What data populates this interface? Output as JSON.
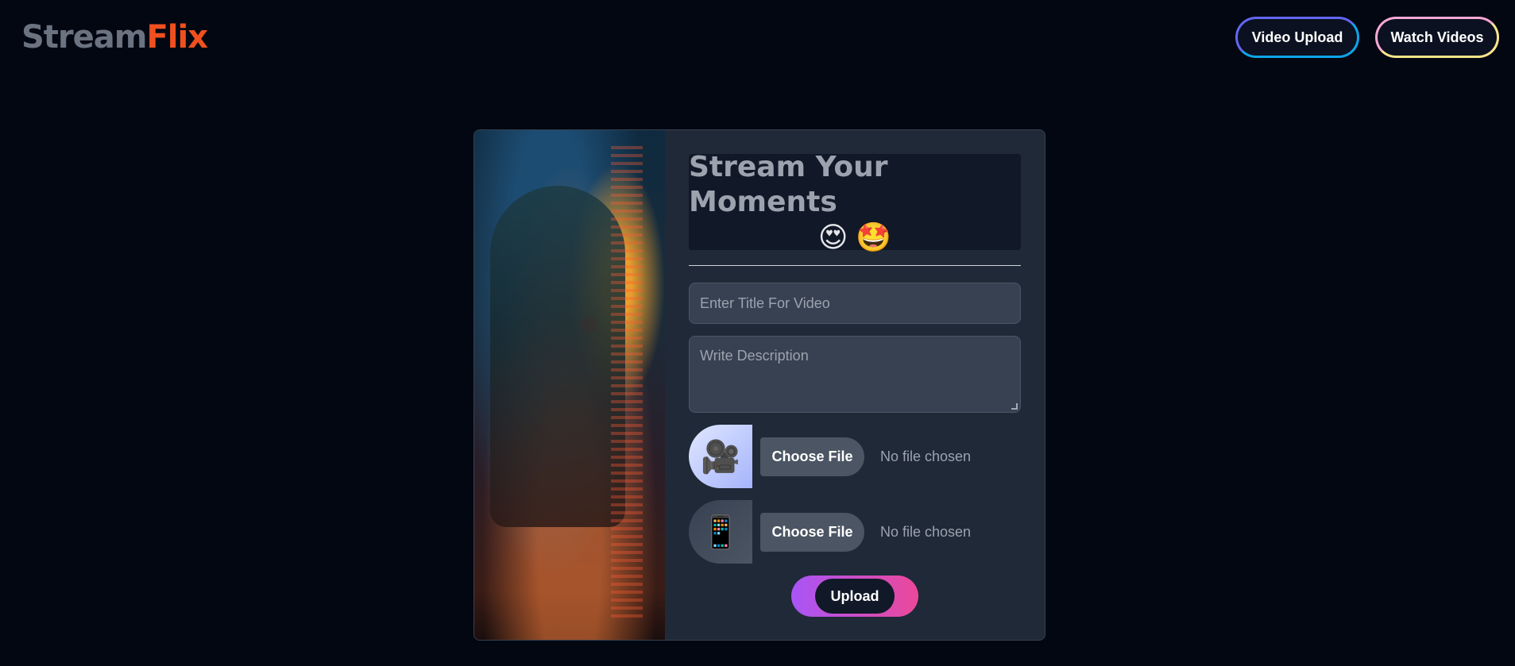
{
  "header": {
    "logo_part1": "Stream",
    "logo_part2": "Flix",
    "nav": {
      "video_upload": "Video Upload",
      "watch_videos": "Watch Videos"
    }
  },
  "form": {
    "heading": "Stream Your Moments",
    "heading_emoji": "😍 🤩",
    "title_placeholder": "Enter Title For Video",
    "description_placeholder": "Write Description",
    "video_file": {
      "button": "Choose File",
      "status": "No file chosen",
      "thumb_icon": "🎥"
    },
    "thumbnail_file": {
      "button": "Choose File",
      "status": "No file chosen",
      "thumb_icon": "📱"
    },
    "submit": "Upload"
  },
  "colors": {
    "background": "#030712",
    "logo_gray": "#6b7280",
    "logo_orange": "#f0501e",
    "card": "#1f2937",
    "upload_gradient_start": "#a855f7",
    "upload_gradient_end": "#ec4899"
  }
}
